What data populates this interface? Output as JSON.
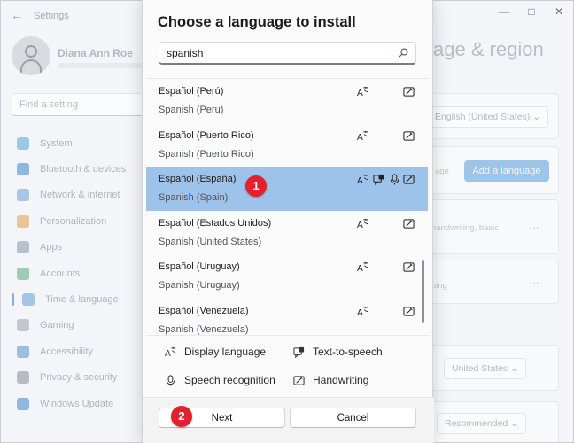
{
  "settings": {
    "app_title": "Settings",
    "user_name": "Diana Ann Roe",
    "find_placeholder": "Find a setting",
    "page_title_partial": "age & region",
    "nav": [
      {
        "label": "System",
        "color": "#9cc6ea"
      },
      {
        "label": "Bluetooth & devices",
        "color": "#8fb7e0"
      },
      {
        "label": "Network & internet",
        "color": "#a9c6e6"
      },
      {
        "label": "Personalization",
        "color": "#e8c39b"
      },
      {
        "label": "Apps",
        "color": "#b8c1cc"
      },
      {
        "label": "Accounts",
        "color": "#9dcbb4"
      },
      {
        "label": "Time & language",
        "color": "#a6c4e4"
      },
      {
        "label": "Gaming",
        "color": "#c3c7cd"
      },
      {
        "label": "Accessibility",
        "color": "#9fbde0"
      },
      {
        "label": "Privacy & security",
        "color": "#b6bcc4"
      },
      {
        "label": "Windows Update",
        "color": "#8fb7e0"
      }
    ],
    "active_nav_index": 6,
    "language_select": "English (United States)",
    "age_partial": "age",
    "add_language_button": "Add a language",
    "features_partial": "handwriting, basic",
    "typing_partial": "ping",
    "region_select": "United States",
    "format_select": "Recommended"
  },
  "dialog": {
    "title": "Choose a language to install",
    "search_value": "spanish",
    "languages": [
      {
        "native": "Español (Perú)",
        "english": "Spanish (Peru)",
        "features": [
          "display",
          "handwriting"
        ]
      },
      {
        "native": "Español (Puerto Rico)",
        "english": "Spanish (Puerto Rico)",
        "features": [
          "display",
          "handwriting"
        ]
      },
      {
        "native": "Español (España)",
        "english": "Spanish (Spain)",
        "features": [
          "display",
          "tts",
          "speech",
          "handwriting"
        ],
        "selected": true
      },
      {
        "native": "Español (Estados Unidos)",
        "english": "Spanish (United States)",
        "features": [
          "display",
          "handwriting"
        ]
      },
      {
        "native": "Español (Uruguay)",
        "english": "Spanish (Uruguay)",
        "features": [
          "display",
          "handwriting"
        ]
      },
      {
        "native": "Español (Venezuela)",
        "english": "Spanish (Venezuela)",
        "features": [
          "display",
          "handwriting"
        ]
      }
    ],
    "legend": {
      "display_language": "Display language",
      "text_to_speech": "Text-to-speech",
      "speech_recognition": "Speech recognition",
      "handwriting": "Handwriting"
    },
    "next_button": "Next",
    "cancel_button": "Cancel",
    "callout_1": "1",
    "callout_2": "2",
    "accent_selected": "#9ec3ea",
    "callout_color": "#e1222c"
  }
}
